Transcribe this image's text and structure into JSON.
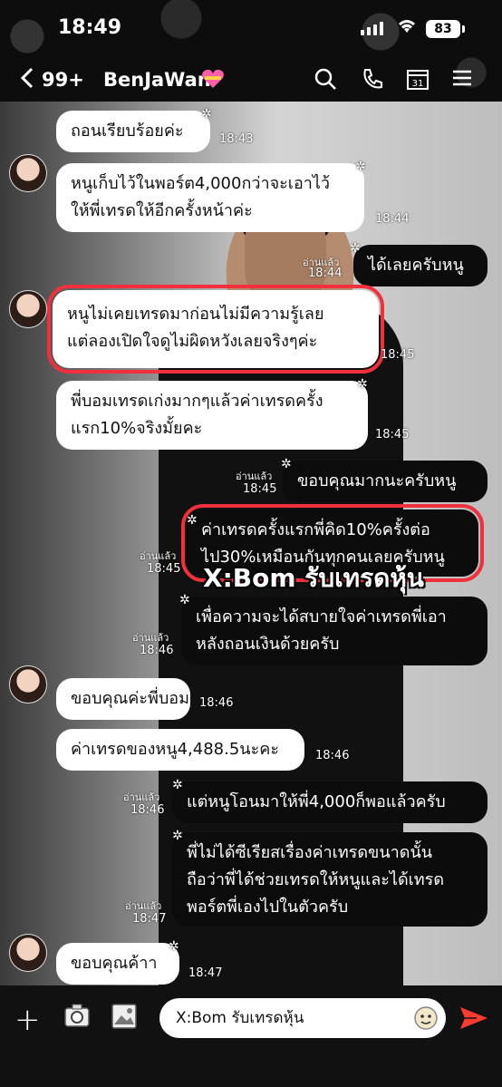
{
  "status": {
    "time": "18:49",
    "battery": "83"
  },
  "header": {
    "back_count": "99+",
    "chat_name": "BenJaWan"
  },
  "read_label": "อ่านแล้ว",
  "messages": [
    {
      "text": [
        "ถอนเรียบร้อยค่ะ"
      ],
      "time": "18:43"
    },
    {
      "text": [
        "หนูเก็บไว้ในพอร์ต4,000กว่าจะเอาไว้",
        "ให้พี่เทรดให้อีกครั้งหน้าค่ะ"
      ],
      "time": "18:44"
    },
    {
      "text": [
        "ได้เลยครับหนู"
      ],
      "time": "18:44"
    },
    {
      "text": [
        "หนูไม่เคยเทรดมาก่อนไม่มีความรู้เลย",
        "แต่ลองเปิดใจดูไม่ผิดหวังเลยจริงๆค่ะ"
      ],
      "time": "18:45"
    },
    {
      "text": [
        "พี่บอมเทรดเก่งมากๆแล้วค่าเทรดครั้ง",
        "แรก10%จริงมั้ยคะ"
      ],
      "time": "18:45"
    },
    {
      "text": [
        "ขอบคุณมากนะครับหนู"
      ],
      "time": "18:45"
    },
    {
      "text": [
        "ค่าเทรดครั้งแรกพี่คิด10%ครั้งต่อ",
        "ไป30%เหมือนกันทุกคนเลยครับหนู"
      ],
      "time": "18:45"
    },
    {
      "text": [
        "เพื่อความจะได้สบายใจค่าเทรดพี่เอา",
        "หลังถอนเงินด้วยครับ"
      ],
      "time": "18:46"
    },
    {
      "text": [
        "ขอบคุณค่ะพี่บอม"
      ],
      "time": "18:46"
    },
    {
      "text": [
        "ค่าเทรดของหนู4,488.5นะคะ"
      ],
      "time": "18:46"
    },
    {
      "text": [
        "แต่หนูโอนมาให้พี่4,000ก็พอแล้วครับ"
      ],
      "time": "18:46"
    },
    {
      "text": [
        "พี่ไม่ได้ซีเรียสเรื่องค่าเทรดขนาดนั้น",
        "ถือว่าพี่ได้ช่วยเทรดให้หนูและได้เทรด",
        "พอร์ตพี่เองไปในตัวครับ"
      ],
      "time": "18:47"
    },
    {
      "text": [
        "ขอบคุณค้าา"
      ],
      "time": "18:47"
    }
  ],
  "watermark": "X:Bom รับเทรดหุ้น",
  "input": {
    "value": "X:Bom รับเทรดหุ้น"
  },
  "colors": {
    "highlight": "#f0303d",
    "send": "#ff3b2f",
    "outgoing_bubble": "#0c0c0c",
    "incoming_bubble": "#ffffff"
  },
  "icons": [
    "back-chevron-icon",
    "heart-emoji-icon",
    "search-icon",
    "phone-icon",
    "calendar-icon",
    "menu-icon",
    "plus-icon",
    "camera-icon",
    "image-icon",
    "emoji-icon",
    "send-icon"
  ]
}
